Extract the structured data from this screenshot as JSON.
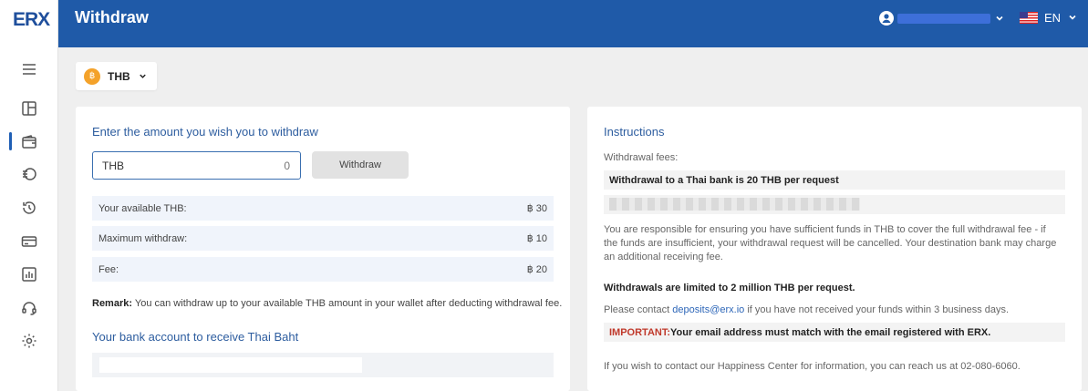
{
  "app": {
    "logo": "ERX",
    "page_title": "Withdraw"
  },
  "header": {
    "language": "EN"
  },
  "sidebar": {
    "items": [
      {
        "icon": "menu-icon"
      },
      {
        "icon": "dashboard-icon"
      },
      {
        "icon": "wallet-icon",
        "active": true
      },
      {
        "icon": "exchange-icon"
      },
      {
        "icon": "history-icon"
      },
      {
        "icon": "card-icon"
      },
      {
        "icon": "report-icon"
      },
      {
        "icon": "support-icon"
      },
      {
        "icon": "settings-icon"
      }
    ]
  },
  "currency_selector": {
    "coin_symbol": "฿",
    "label": "THB"
  },
  "withdraw_form": {
    "title": "Enter the amount you wish you to withdraw",
    "input_currency": "THB",
    "input_value": "0",
    "button_label": "Withdraw",
    "rows": [
      {
        "label": "Your available THB:",
        "value": "฿ 30"
      },
      {
        "label": "Maximum withdraw:",
        "value": "฿ 10"
      },
      {
        "label": "Fee:",
        "value": "฿ 20"
      }
    ],
    "remark_label": "Remark:",
    "remark_text": "You can withdraw up to your available THB amount in your wallet after deducting withdrawal fee.",
    "bank_title": "Your bank account to receive Thai Baht"
  },
  "instructions": {
    "title": "Instructions",
    "fees_label": "Withdrawal fees:",
    "fee_line": "Withdrawal to a Thai bank is 20 THB per request",
    "responsibility_text": "You are responsible for ensuring you have sufficient funds in THB to cover the full withdrawal fee - if the funds are insufficient, your withdrawal request will be cancelled. Your destination bank may charge an additional receiving fee.",
    "limit_text": "Withdrawals are limited to 2 million THB per request.",
    "contact_prefix": "Please contact ",
    "contact_email": "deposits@erx.io",
    "contact_suffix": " if you have not received your funds within 3 business days.",
    "important_label": "IMPORTANT:",
    "important_text": " Your email address must match with the email registered with ERX.",
    "happiness_text": "If you wish to contact our Happiness Center for information, you can reach us at 02-080-6060."
  },
  "colors": {
    "brand_blue": "#1f5aa8",
    "accent_link": "#2d66b8",
    "coin_orange": "#f4a22a",
    "important_red": "#c0392b"
  }
}
